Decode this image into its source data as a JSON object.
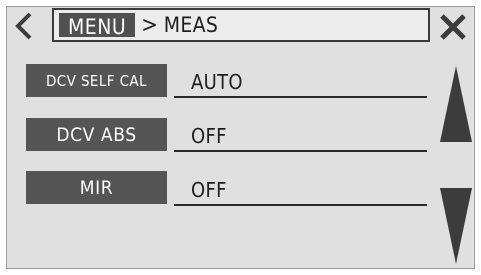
{
  "header": {
    "menu_label": "MENU",
    "separator": ">",
    "current": "MEAS"
  },
  "icons": {
    "back": "chevron-left-icon",
    "close": "close-x-icon",
    "scroll_up": "triangle-up-icon",
    "scroll_down": "triangle-down-icon"
  },
  "settings": [
    {
      "label": "DCV SELF CAL",
      "value": "AUTO"
    },
    {
      "label": "DCV ABS",
      "value": "OFF"
    },
    {
      "label": "MIR",
      "value": "OFF"
    }
  ],
  "colors": {
    "panel_bg": "#e0e0e0",
    "label_bg": "#555555",
    "label_text": "#ffffff",
    "icon": "#3c3c3c"
  }
}
